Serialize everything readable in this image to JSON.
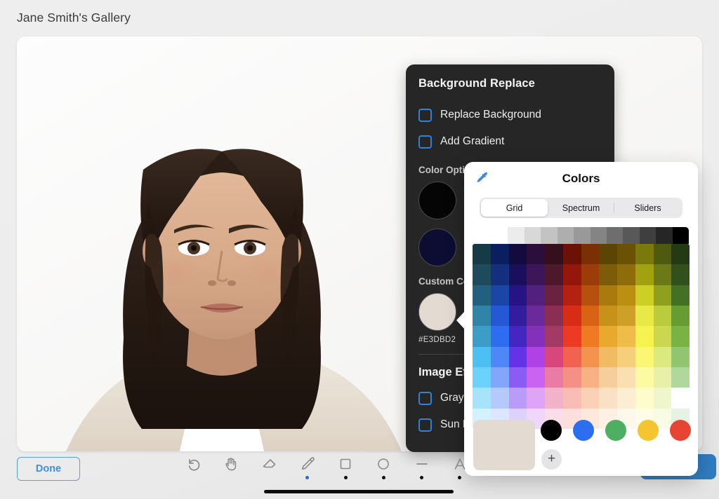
{
  "header": {
    "title": "Jane Smith's Gallery"
  },
  "photo": {
    "alt": "Portrait photograph of a woman with long dark hair on a white background",
    "background": "#fbfbfb"
  },
  "bottom_bar": {
    "done_label": "Done",
    "tools": [
      {
        "name": "undo-tool",
        "icon": "undo-icon",
        "dot": "none",
        "active": false
      },
      {
        "name": "pan-tool",
        "icon": "hand-icon",
        "dot": "none",
        "active": false
      },
      {
        "name": "eraser-tool",
        "icon": "eraser-icon",
        "dot": "none",
        "active": false
      },
      {
        "name": "pencil-tool",
        "icon": "pencil-icon",
        "dot": "blue",
        "active": true
      },
      {
        "name": "rectangle-tool",
        "icon": "square-icon",
        "dot": "black",
        "active": false
      },
      {
        "name": "ellipse-tool",
        "icon": "circle-icon",
        "dot": "black",
        "active": false
      },
      {
        "name": "line-tool",
        "icon": "line-icon",
        "dot": "black",
        "active": false
      },
      {
        "name": "text-tool",
        "icon": "text-a-icon",
        "dot": "black",
        "active": false
      }
    ]
  },
  "dark_panel": {
    "title": "Background Replace",
    "checkboxes": [
      {
        "label": "Replace Background",
        "checked": false
      },
      {
        "label": "Add Gradient",
        "checked": false
      }
    ],
    "color_options_heading": "Color Options",
    "color_options": [
      {
        "name": "black-swatch",
        "hex": "#050505"
      },
      {
        "name": "navy-swatch",
        "hex": "#0d0d33"
      }
    ],
    "custom_color_heading": "Custom Color",
    "custom_color": {
      "hex": "#E3DBD2",
      "label": "#E3DBD2"
    },
    "image_effects_heading": "Image Effects",
    "effects": [
      {
        "label": "Grayscale",
        "checked": false
      },
      {
        "label": "Sun Damage",
        "checked": false
      }
    ],
    "accent": "#2f82d8",
    "panel_background": "#262626"
  },
  "colors_popover": {
    "title": "Colors",
    "eyedropper_icon": "eyedropper-icon",
    "tabs": [
      {
        "label": "Grid",
        "selected": true
      },
      {
        "label": "Spectrum",
        "selected": false
      },
      {
        "label": "Sliders",
        "selected": false
      }
    ],
    "grayscale_row": [
      "#ffffff",
      "#ececec",
      "#d8d8d8",
      "#c3c3c3",
      "#aeaeae",
      "#999999",
      "#848484",
      "#6e6e6e",
      "#585858",
      "#3f3f3f",
      "#262626",
      "#000000"
    ],
    "grid_rows": [
      [
        "#173a47",
        "#0b1f60",
        "#130a3d",
        "#2b0f3a",
        "#35101c",
        "#6b1205",
        "#7a2f05",
        "#5c4405",
        "#6b5106",
        "#7a7a0c",
        "#4e5a10",
        "#243a14"
      ],
      [
        "#1d4b5c",
        "#142f7d",
        "#1a0f5c",
        "#3d1659",
        "#4d172c",
        "#93180a",
        "#9c3c09",
        "#7c5c08",
        "#8f6c0a",
        "#a2a211",
        "#6b7a17",
        "#31501c"
      ],
      [
        "#236080",
        "#1c45a8",
        "#271484",
        "#54207d",
        "#6b2240",
        "#b32210",
        "#b74f0e",
        "#a97b0f",
        "#bb8f11",
        "#ccd024",
        "#8fa01f",
        "#447026"
      ],
      [
        "#2f84a8",
        "#2458d4",
        "#331c9d",
        "#6a2a99",
        "#8a2f53",
        "#d72d16",
        "#d96315",
        "#c8921a",
        "#cfa028",
        "#e9e849",
        "#bacb3b",
        "#679c33"
      ],
      [
        "#3b9ec9",
        "#2f6df0",
        "#4426c0",
        "#8430bb",
        "#a33a65",
        "#ec3b22",
        "#ef7a22",
        "#e9a92f",
        "#eebc4a",
        "#f6f24f",
        "#cbd84f",
        "#79b245"
      ],
      [
        "#4dc0f2",
        "#4f86f8",
        "#6433e8",
        "#b041e6",
        "#d9467e",
        "#f26251",
        "#f4924f",
        "#f1bb63",
        "#f5cf7a",
        "#fbf775",
        "#dce97d",
        "#92c56f"
      ],
      [
        "#6bd3fb",
        "#81a6fb",
        "#8b5cf5",
        "#cb63f2",
        "#ea7ba4",
        "#f59085",
        "#f7b184",
        "#f6ce9d",
        "#fadfb0",
        "#fdfaa4",
        "#e7f0a8",
        "#b0d79c"
      ],
      [
        "#a4e4fd",
        "#b6c9fd",
        "#b89cf8",
        "#dfa4f7",
        "#f2b2ca",
        "#f9bdb6",
        "#fad0b6",
        "#fae1c6",
        "#fceed2",
        "#fefcca",
        "#f0f6cc",
        "#ccе6c2"
      ],
      [
        "#d4f2fe",
        "#dce6fe",
        "#ddd2fb",
        "#efd6fb",
        "#f9dde9",
        "#fcdedb",
        "#fde8dc",
        "#fdf0e4",
        "#fef7ec",
        "#fffde8",
        "#f8fbe6",
        "#e6f3e2"
      ]
    ],
    "preview_color": "#e3dbd2",
    "recent_colors": [
      "#000000",
      "#2b6ef0",
      "#4caf62",
      "#f4c531",
      "#e84434"
    ],
    "add_button_label": "+"
  },
  "panel_action": {
    "name": "apply-button",
    "color": "#2f7cc0"
  }
}
